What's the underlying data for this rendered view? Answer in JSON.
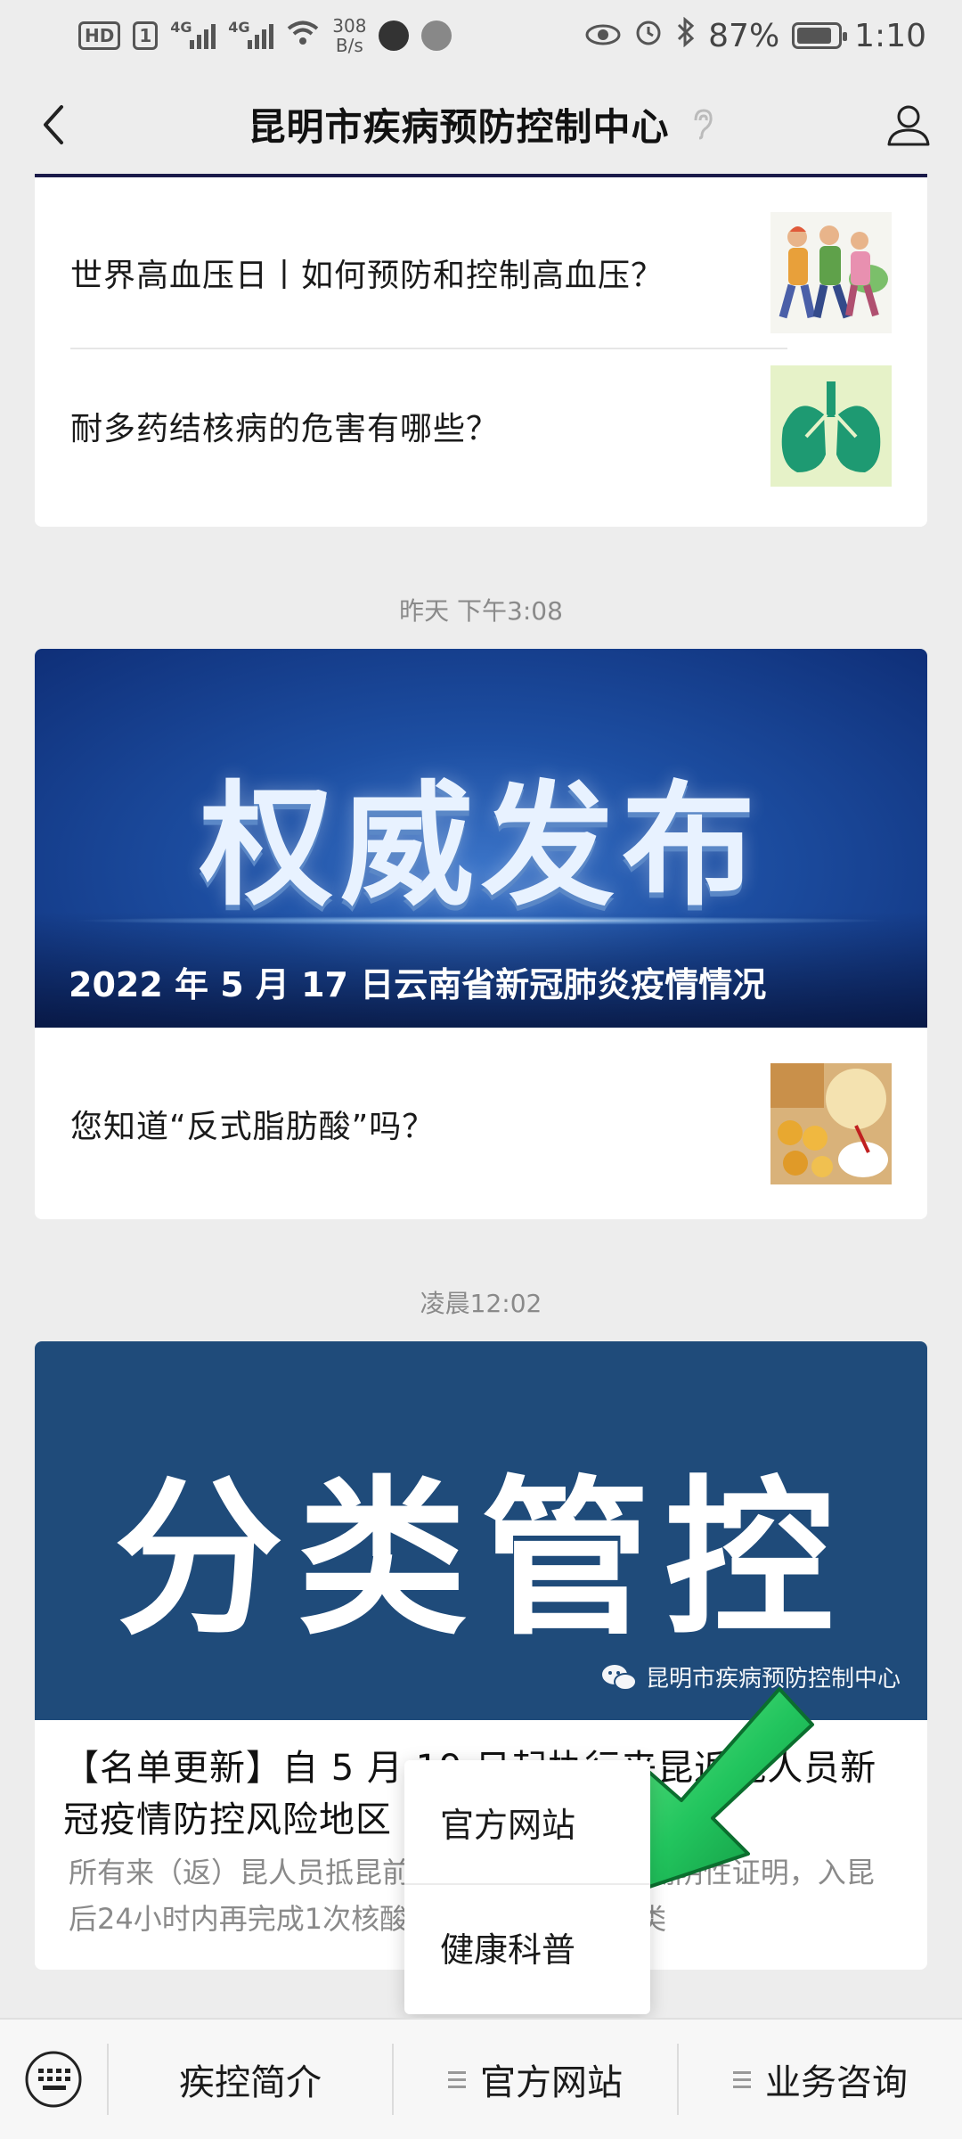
{
  "status_bar": {
    "hd_label": "HD",
    "sim_label": "1",
    "network_1": "4G",
    "network_2": "4G",
    "speed_value": "308",
    "speed_unit": "B/s",
    "battery": "87%",
    "battery_level": 0.87,
    "time": "1:10"
  },
  "nav": {
    "title": "昆明市疾病预防控制中心"
  },
  "articles_top": [
    {
      "title": "世界高血压日丨如何预防和控制高血压？",
      "thumb_icon": "walking-people-thumbnail"
    },
    {
      "title": "耐多药结核病的危害有哪些？",
      "thumb_icon": "lungs-thumbnail"
    }
  ],
  "time_1": "昨天 下午3:08",
  "message_2": {
    "banner_text": "权威发布",
    "banner_caption": "2022 年 5 月 17 日云南省新冠肺炎疫情情况",
    "article_title": "您知道“反式脂肪酸”吗？",
    "thumb_icon": "food-thumbnail"
  },
  "time_2": "凌晨12:02",
  "message_3": {
    "banner_text": "分类管控",
    "watermark": "昆明市疾病预防控制中心",
    "headline": "【名单更新】自 5 月 19 日起执行来昆返昆人员新冠疫情防控风险地区",
    "excerpt": "所有来（返）昆人员抵昆前持48小时内核酸检测阴性证明，入昆后24小时内再完成1次核酸检测……A、B、C类"
  },
  "popup_menu": {
    "items": [
      "官方网站",
      "健康科普"
    ]
  },
  "bottom_menu": {
    "items": [
      "疾控简介",
      "官方网站",
      "业务咨询"
    ]
  },
  "colors": {
    "background": "#ededed",
    "card": "#ffffff",
    "banner_blue": "#1d4fa3",
    "banner_navy": "#1f4b7a",
    "arrow_green": "#22c55e"
  }
}
